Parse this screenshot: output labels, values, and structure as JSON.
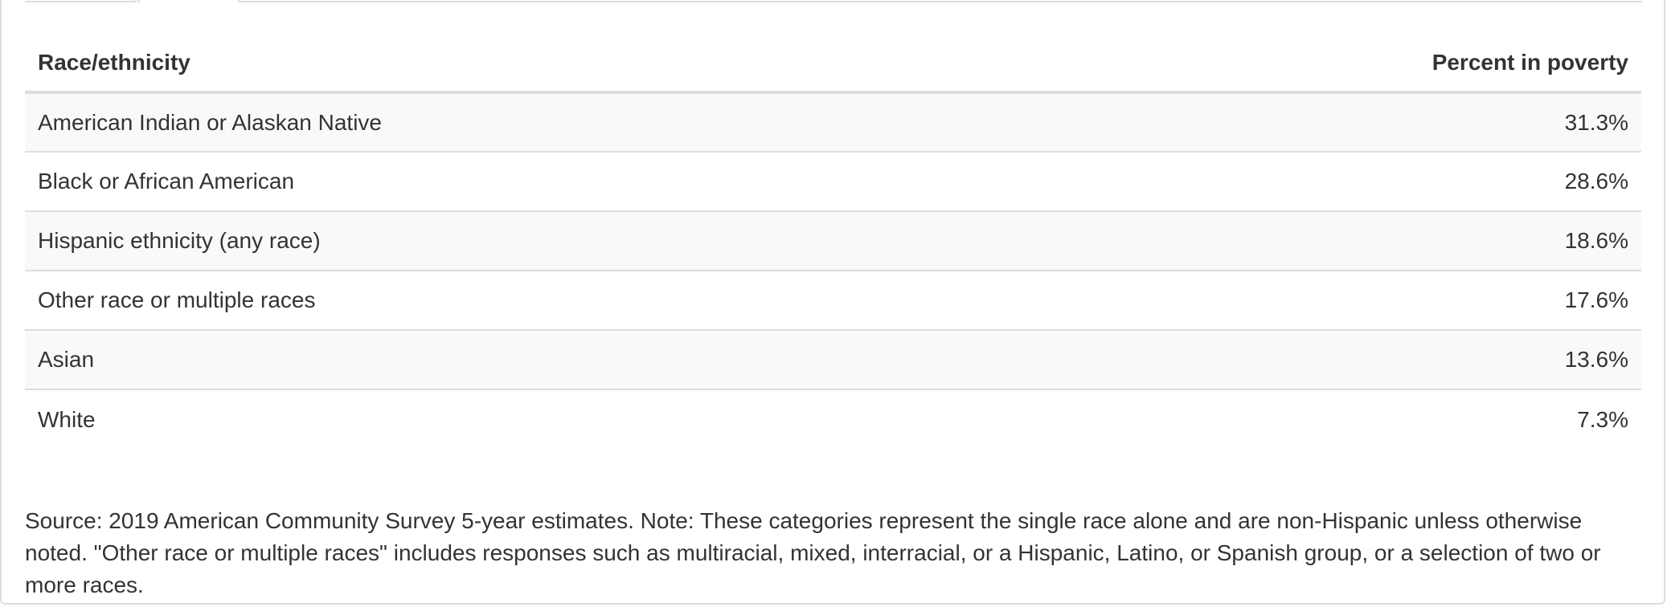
{
  "table": {
    "headers": {
      "category": "Race/ethnicity",
      "value": "Percent in poverty"
    },
    "rows": [
      {
        "label": "American Indian or Alaskan Native",
        "value": "31.3%"
      },
      {
        "label": "Black or African American",
        "value": "28.6%"
      },
      {
        "label": "Hispanic ethnicity (any race)",
        "value": "18.6%"
      },
      {
        "label": "Other race or multiple races",
        "value": "17.6%"
      },
      {
        "label": "Asian",
        "value": "13.6%"
      },
      {
        "label": "White",
        "value": "7.3%"
      }
    ]
  },
  "source_note": "Source: 2019 American Community Survey 5-year estimates. Note: These categories represent the single race alone and are non-Hispanic unless otherwise noted. \"Other race or multiple races\" includes responses such as multiracial, mixed, interracial, or a Hispanic, Latino, or Spanish group, or a selection of two or more races.",
  "colors": {
    "border": "#dddddd",
    "stripe": "#f9f9f9",
    "text": "#333333"
  }
}
